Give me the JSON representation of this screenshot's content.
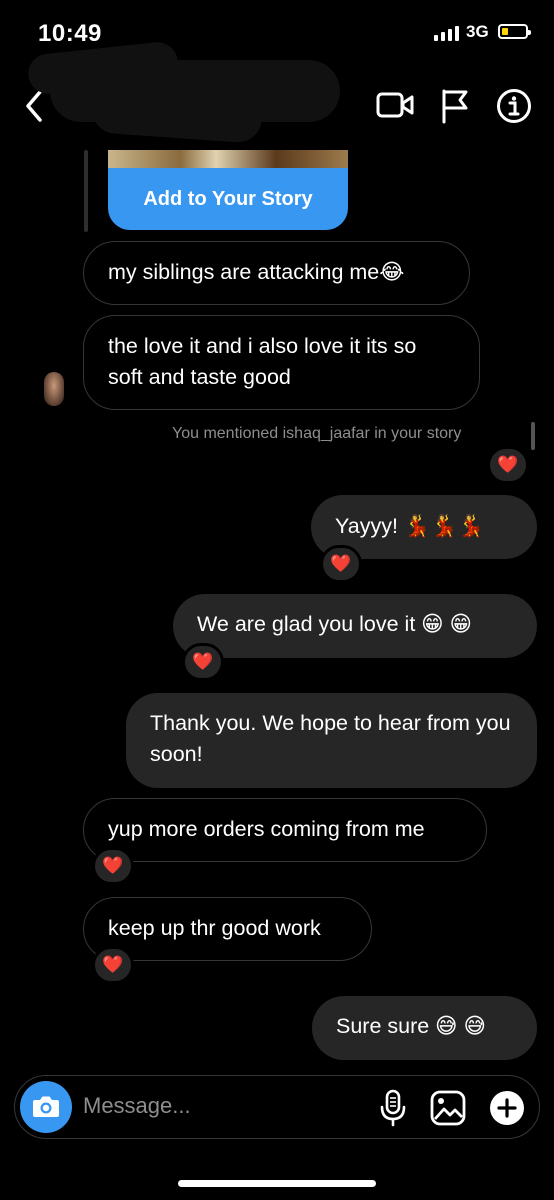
{
  "status_bar": {
    "time": "10:49",
    "network": "3G"
  },
  "header": {
    "icons": [
      "back-chevron-icon",
      "video-call-icon",
      "flag-icon",
      "info-icon"
    ]
  },
  "story_card": {
    "button_label": "Add to Your Story"
  },
  "messages": [
    {
      "side": "in",
      "text": "my siblings are attacking me😂"
    },
    {
      "side": "in",
      "text": "the love it and i also love it its so soft and taste good"
    },
    {
      "side": "out",
      "text": "Yayyy! 💃💃💃",
      "reaction": "❤️"
    },
    {
      "side": "out",
      "text": "We are glad you love it 😁 😁",
      "reaction": "❤️"
    },
    {
      "side": "out",
      "text": "Thank you. We hope to hear from you soon!"
    },
    {
      "side": "in",
      "text": "yup more orders coming from me",
      "reaction": "❤️"
    },
    {
      "side": "in",
      "text": "keep up thr good work",
      "reaction": "❤️"
    },
    {
      "side": "out",
      "text": "Sure sure 😅 😅"
    }
  ],
  "story_mention": {
    "text": "You mentioned ishaq_jaafar in your story",
    "reaction": "❤️"
  },
  "composer": {
    "placeholder": "Message...",
    "icons": [
      "camera-icon",
      "microphone-icon",
      "gallery-icon",
      "add-icon"
    ]
  },
  "colors": {
    "accent": "#3897f0",
    "outgoing_bubble": "#262626",
    "heart": "#ff3b45",
    "background": "#000000"
  }
}
